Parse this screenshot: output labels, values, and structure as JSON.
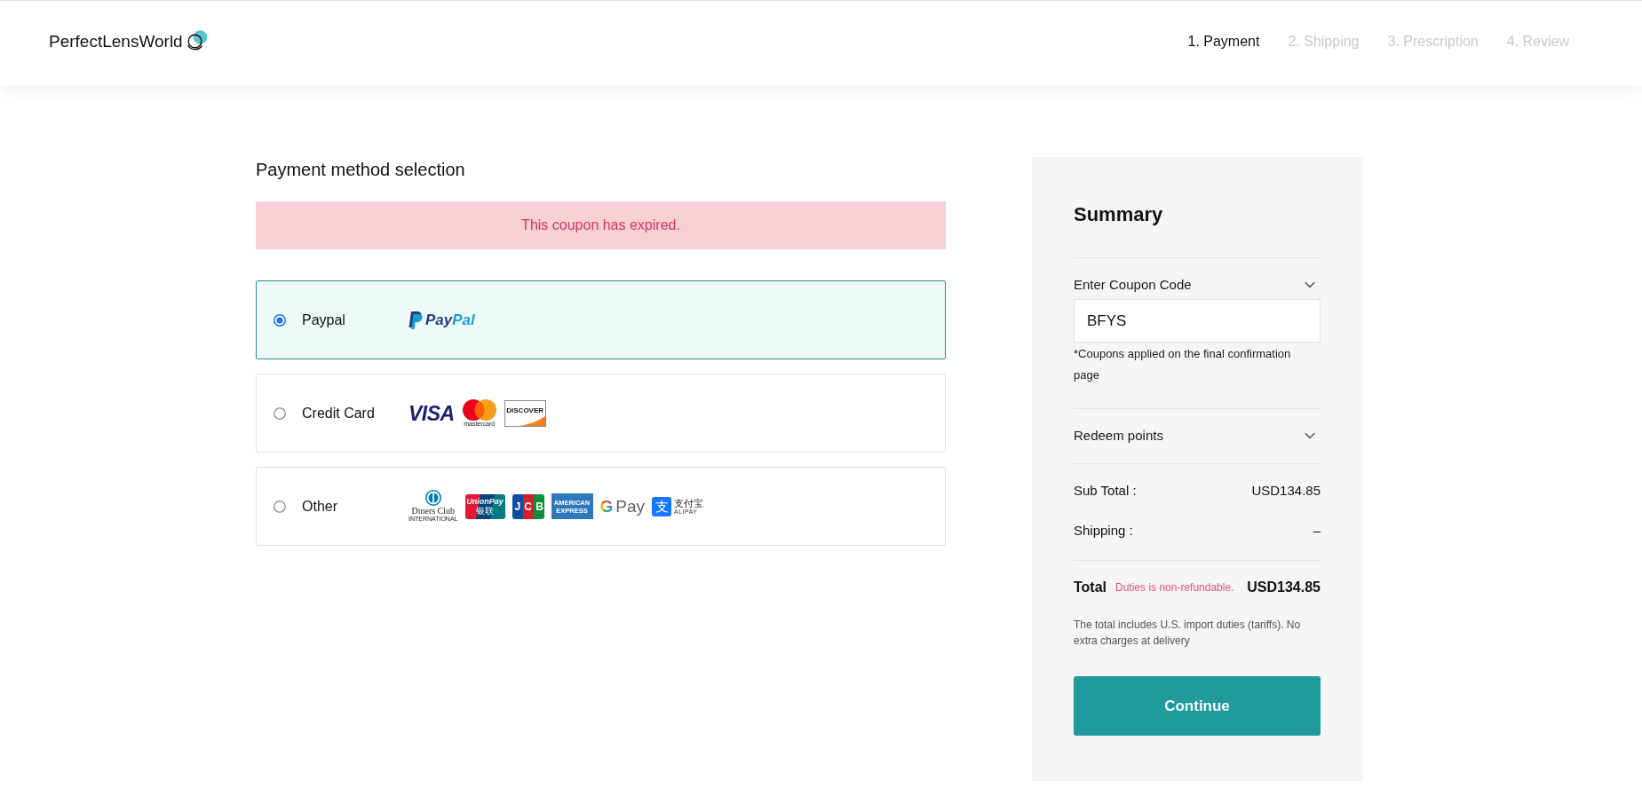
{
  "header": {
    "logo": "PerfectLensWorld",
    "steps": [
      {
        "label": "1. Payment",
        "selected": true
      },
      {
        "label": "2. Shipping",
        "selected": false
      },
      {
        "label": "3. Prescription",
        "selected": false
      },
      {
        "label": "4. Review",
        "selected": false
      }
    ]
  },
  "payment": {
    "title": "Payment method selection",
    "alert": "This coupon has expired.",
    "methods": [
      {
        "label": "Paypal",
        "selected": true,
        "logos": [
          {
            "kind": "paypal",
            "text": "PayPal"
          }
        ]
      },
      {
        "label": "Credit Card",
        "selected": false,
        "logos": [
          {
            "kind": "visa",
            "text": "VISA"
          },
          {
            "kind": "mastercard",
            "text": "mastercard"
          },
          {
            "kind": "discover",
            "text": "DISCOVER"
          }
        ]
      },
      {
        "label": "Other",
        "selected": false,
        "logos": [
          {
            "kind": "diners",
            "text": "Diners Club",
            "caption": "INTERNATIONAL"
          },
          {
            "kind": "unionpay",
            "text": "UnionPay",
            "caption": "银联"
          },
          {
            "kind": "jcb",
            "text": "JCB"
          },
          {
            "kind": "amex",
            "text": "AMERICAN EXPRESS"
          },
          {
            "kind": "gpay",
            "mark": "G",
            "text": "Pay"
          },
          {
            "kind": "alipay",
            "mark": "支",
            "text": "支付宝",
            "caption": "ALIPAY"
          }
        ]
      }
    ]
  },
  "summary": {
    "title": "Summary",
    "coupon": {
      "label": "Enter Coupon Code",
      "value": "BFYS",
      "note": "*Coupons applied on the final confirmation page"
    },
    "points": {
      "label": "Redeem points"
    },
    "rows": [
      {
        "label": "Sub Total :",
        "value": "USD134.85"
      },
      {
        "label": "Shipping :",
        "value": "–"
      }
    ],
    "total": {
      "label": "Total",
      "note": "Duties is non-refundable.",
      "value": "USD134.85"
    },
    "total_note": "The total includes U.S. import duties (tariffs). No extra charges at delivery",
    "button": "Continue"
  }
}
